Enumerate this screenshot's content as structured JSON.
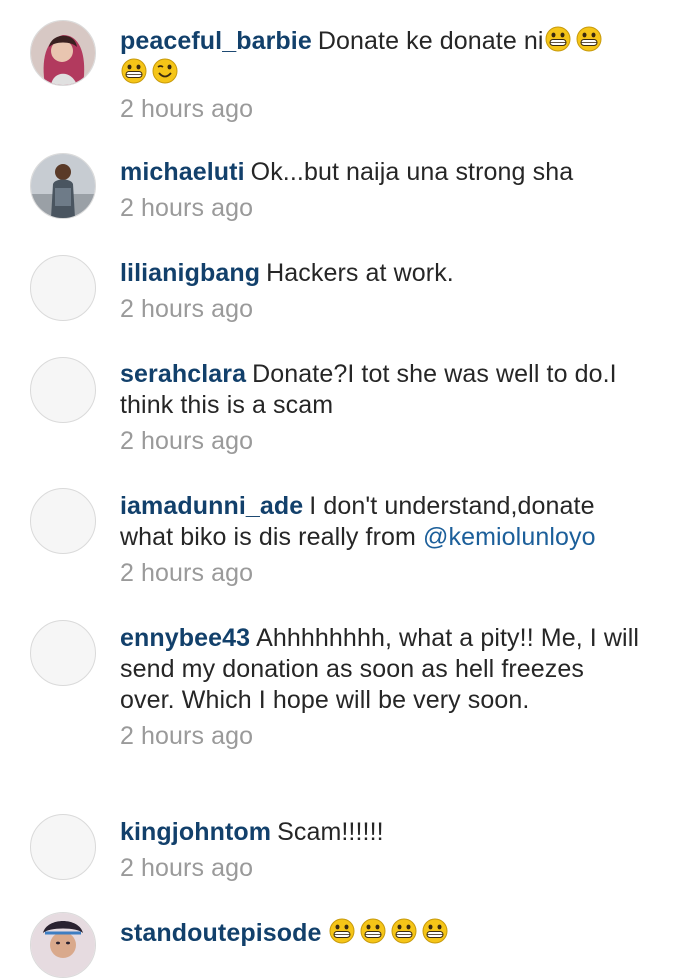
{
  "comments": [
    {
      "username": "peaceful_barbie",
      "text": "Donate ke donate ni",
      "emoji_after": [
        "grin-icon",
        "grin-icon",
        "grin-icon",
        "wink-icon"
      ],
      "time": "2 hours ago",
      "avatar": "photo"
    },
    {
      "username": "michaeluti",
      "text": "Ok...but naija una strong sha",
      "time": "2 hours ago",
      "avatar": "photo"
    },
    {
      "username": "lilianigbang",
      "text": "Hackers at work.",
      "time": "2 hours ago",
      "avatar": "placeholder"
    },
    {
      "username": "serahclara",
      "text": "Donate?I tot she was well to do.I think this is a scam",
      "time": "2 hours ago",
      "avatar": "placeholder"
    },
    {
      "username": "iamadunni_ade",
      "text": "I don't understand,donate what biko is dis really from ",
      "mention": "@kemiolunloyo",
      "time": "2 hours ago",
      "avatar": "placeholder"
    },
    {
      "username": "ennybee43",
      "text": "Ahhhhhhhh,  what a pity!! Me, I will send my donation as soon as hell freezes over. Which I hope will be very soon.",
      "time": "2 hours ago",
      "avatar": "placeholder"
    },
    {
      "username": "kingjohntom",
      "text": "Scam!!!!!!",
      "time": "2 hours ago",
      "avatar": "placeholder"
    },
    {
      "username": "standoutepisode",
      "emoji_after": [
        "grin-icon",
        "grin-icon",
        "grin-icon",
        "grin-icon"
      ],
      "avatar": "photo"
    }
  ],
  "colors": {
    "username": "#12406b",
    "text": "#262626",
    "timestamp": "#9a9a9a",
    "mention": "#1c5f9a",
    "emoji_face": "#f5c518"
  }
}
